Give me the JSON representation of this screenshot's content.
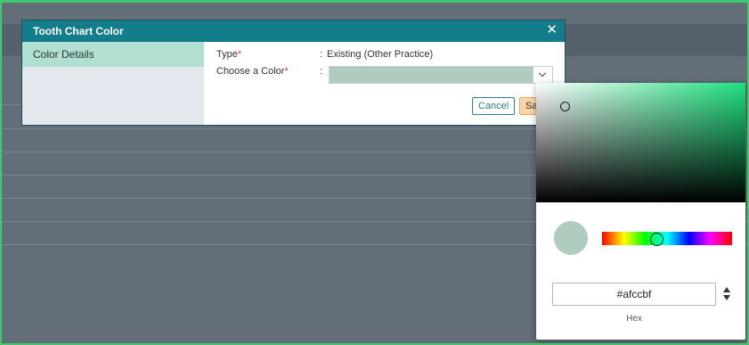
{
  "dialog": {
    "title": "Tooth Chart Color",
    "close_glyph": "✕",
    "sidebar": {
      "items": [
        {
          "label": "Color Details"
        }
      ]
    },
    "fields": {
      "type": {
        "label": "Type",
        "required_mark": "*",
        "separator": ":",
        "value": "Existing (Other Practice)"
      },
      "color": {
        "label": "Choose a Color",
        "required_mark": "*",
        "separator": ":",
        "value": "#afccbf"
      }
    },
    "buttons": {
      "cancel": "Cancel",
      "save": "Save"
    }
  },
  "color_picker": {
    "hue_color": "#1fe07f",
    "hex_value": "#afccbf",
    "mode_label": "Hex",
    "saturation": 0.12,
    "brightness": 0.84,
    "hue_degrees": 153
  },
  "colors": {
    "header": "#147d8c",
    "sidebar_active": "#b1dfd2",
    "selected_color": "#afccbf",
    "save_button": "#fcd3a8",
    "page_border": "#3ec96a"
  }
}
